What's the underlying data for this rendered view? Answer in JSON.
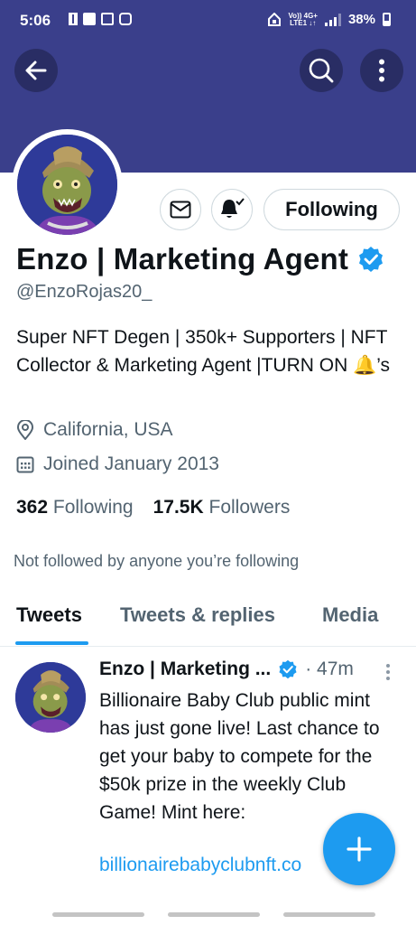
{
  "status_bar": {
    "time": "5:06",
    "network_top": "Vo)) 4G+",
    "network_bottom": "LTE1 ↓↑",
    "battery": "38%"
  },
  "profile": {
    "name": "Enzo | Marketing Agent",
    "handle": "@EnzoRojas20_",
    "verified": true,
    "bio": "Super NFT Degen | 350k+ Supporters | NFT Collector & Marketing Agent |TURN ON 🔔’s",
    "location": "California, USA",
    "joined": "Joined January 2013",
    "following_count": "362",
    "following_label": "Following",
    "followers_count": "17.5K",
    "followers_label": "Followers",
    "not_followed_text": "Not followed by anyone you’re following",
    "follow_button": "Following"
  },
  "tabs": [
    {
      "label": "Tweets",
      "active": true
    },
    {
      "label": "Tweets & replies",
      "active": false
    },
    {
      "label": "Media",
      "active": false
    }
  ],
  "tweet": {
    "author": "Enzo | Marketing ...",
    "time": "· 47m",
    "text": "Billionaire Baby Club public mint has just gone live! Last chance to get your baby to compete for the $50k prize in the weekly Club Game! Mint here:",
    "link": "billionairebabyclubnft.co"
  },
  "icons": {
    "back": "arrow-left-icon",
    "search": "search-icon",
    "more": "more-vertical-icon",
    "message": "envelope-icon",
    "notify": "bell-check-icon",
    "location": "location-pin-icon",
    "calendar": "calendar-icon",
    "verified": "verified-badge-icon",
    "compose": "plus-icon"
  },
  "colors": {
    "banner": "#3a3f8b",
    "accent": "#1d9bf0",
    "secondary_text": "#536471",
    "primary_text": "#0f1419"
  }
}
